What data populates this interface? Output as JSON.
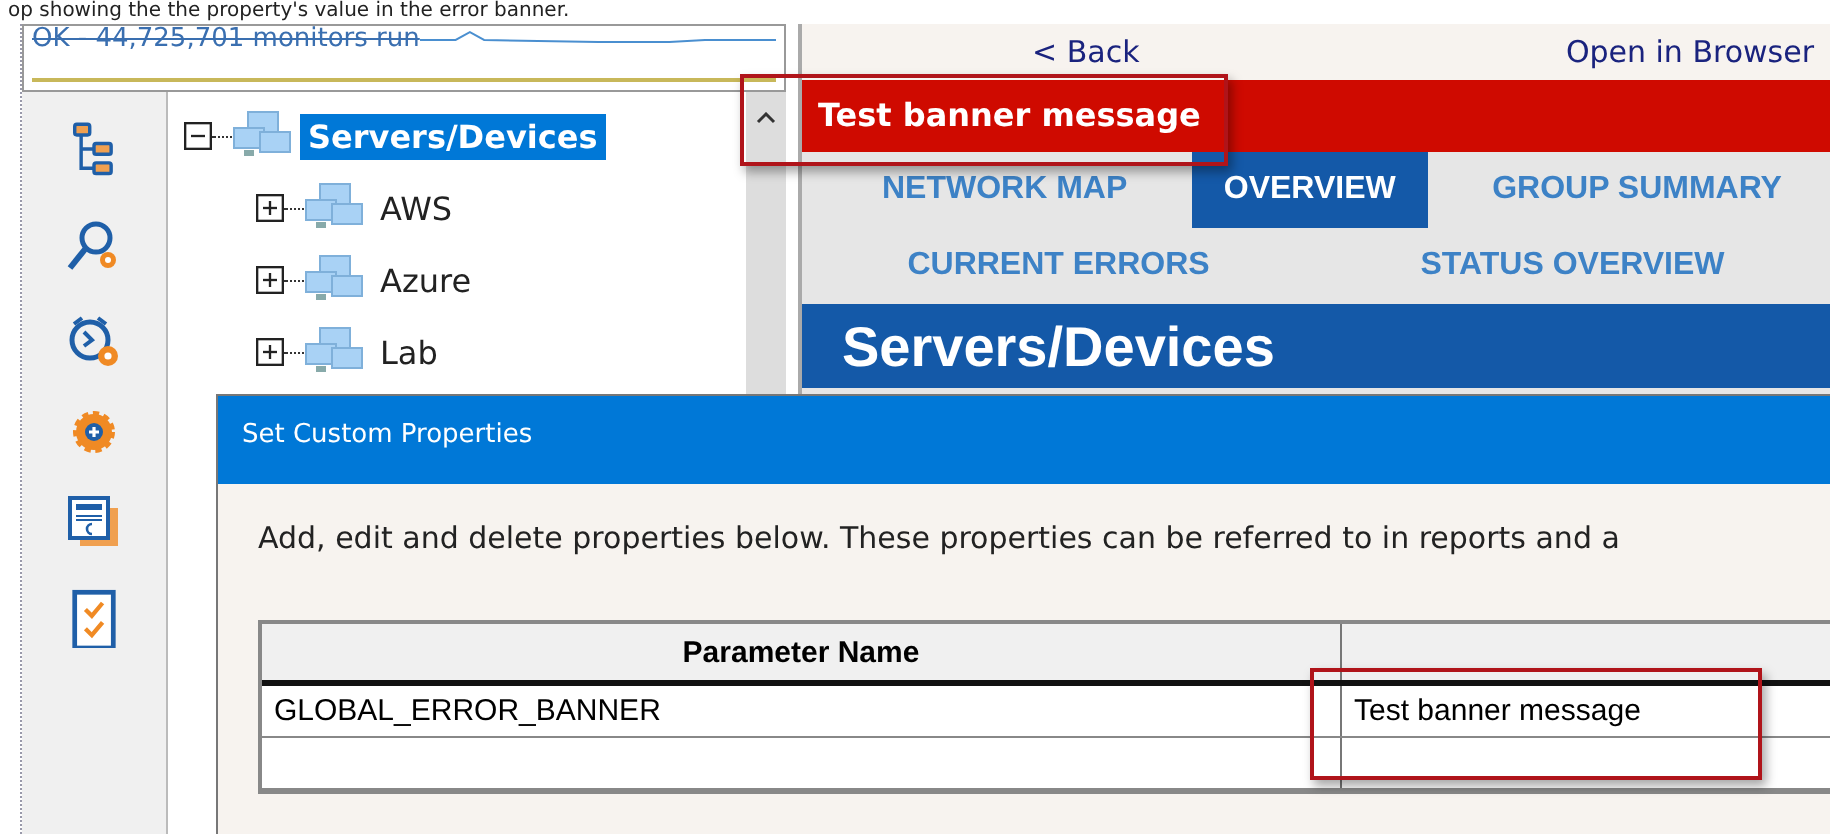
{
  "caption": "op showing the the property's value in the error banner.",
  "status_graph": {
    "text": "OK - 44,725,701 monitors run"
  },
  "tree": {
    "label": "Servers/Devices",
    "expanded": true,
    "selected": true,
    "children": [
      {
        "label": "AWS",
        "expanded": false,
        "selected": false
      },
      {
        "label": "Azure",
        "expanded": false,
        "selected": false
      },
      {
        "label": "Lab",
        "expanded": false,
        "selected": false
      }
    ]
  },
  "nav": {
    "back": "< Back",
    "open": "Open in Browser"
  },
  "banner": "Test banner message",
  "tabs": [
    {
      "label": "NETWORK MAP",
      "selected": false
    },
    {
      "label": "OVERVIEW",
      "selected": true
    },
    {
      "label": "GROUP SUMMARY",
      "selected": false
    },
    {
      "label": "CURRENT ERRORS",
      "selected": false
    },
    {
      "label": "STATUS OVERVIEW",
      "selected": false
    }
  ],
  "page_title": "Servers/Devices",
  "dialog": {
    "title": "Set Custom Properties",
    "description": "Add, edit and delete properties below.  These properties can be referred to in reports and a",
    "table": {
      "columns": [
        "Parameter Name"
      ],
      "rows": [
        [
          "GLOBAL_ERROR_BANNER",
          "Test banner message"
        ]
      ]
    }
  }
}
